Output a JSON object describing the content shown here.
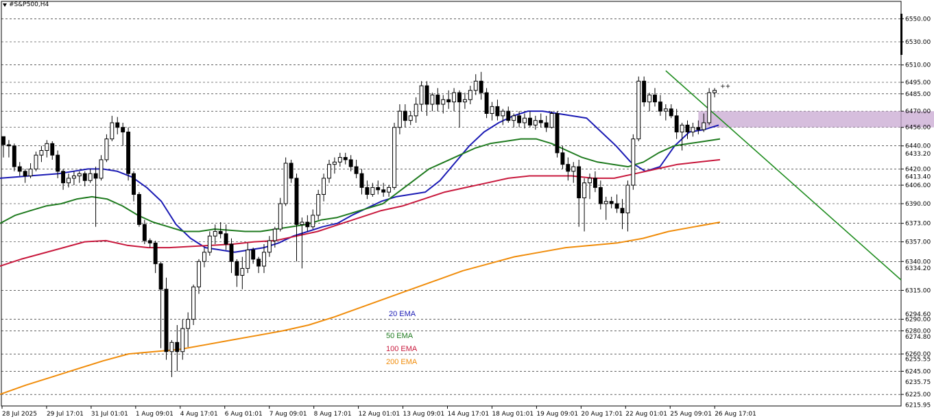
{
  "symbol_label": "#S&P500,H4",
  "colors": {
    "ema20": "#1a1ab4",
    "ema50": "#1e7a1e",
    "ema100": "#c8183c",
    "ema200": "#f08c0a",
    "trendline": "#1e8c1e",
    "zone": "#c8a8d2",
    "grid": "#000000"
  },
  "chart_data": {
    "type": "candlestick",
    "title": "#S&P500,H4",
    "ylim": [
      6215,
      6565
    ],
    "grid": true,
    "y_levels": [
      {
        "label": "6550.00",
        "value": 6550.0
      },
      {
        "label": "6530.00",
        "value": 6530.0
      },
      {
        "label": "6510.00",
        "value": 6510.0
      },
      {
        "label": "6495.00",
        "value": 6495.0
      },
      {
        "label": "6485.00",
        "value": 6485.0
      },
      {
        "label": "6470.00",
        "value": 6470.0
      },
      {
        "label": "6456.00",
        "value": 6456.0
      },
      {
        "label": "6440.00",
        "value": 6440.0
      },
      {
        "label": "6420.00",
        "value": 6420.0
      },
      {
        "label": "6406.00",
        "value": 6406.0
      },
      {
        "label": "6390.00",
        "value": 6390.0
      },
      {
        "label": "6373.00",
        "value": 6373.0
      },
      {
        "label": "6357.00",
        "value": 6357.0
      },
      {
        "label": "6340.00",
        "value": 6340.0
      },
      {
        "label": "6315.00",
        "value": 6315.0
      },
      {
        "label": "6290.00",
        "value": 6290.0
      },
      {
        "label": "6280.00",
        "value": 6280.0
      },
      {
        "label": "6260.00",
        "value": 6260.0
      },
      {
        "label": "6245.00",
        "value": 6245.0
      },
      {
        "label": "6225.00",
        "value": 6225.0
      }
    ],
    "y_minor_labels": [
      "6433.20",
      "6413.40",
      "6334.20",
      "6294.60",
      "6274.80",
      "6255.55",
      "6235.75",
      "6215.95"
    ],
    "x_ticks": [
      {
        "label": "28 Jul 2025",
        "x": 0
      },
      {
        "label": "29 Jul 17:01",
        "x": 11
      },
      {
        "label": "31 Jul 01:01",
        "x": 22
      },
      {
        "label": "1 Aug 09:01",
        "x": 33
      },
      {
        "label": "4 Aug 17:01",
        "x": 44
      },
      {
        "label": "6 Aug 01:01",
        "x": 55
      },
      {
        "label": "7 Aug 09:01",
        "x": 66
      },
      {
        "label": "8 Aug 17:01",
        "x": 77
      },
      {
        "label": "12 Aug 01:01",
        "x": 88
      },
      {
        "label": "13 Aug 09:01",
        "x": 99
      },
      {
        "label": "14 Aug 17:01",
        "x": 110
      },
      {
        "label": "18 Aug 01:01",
        "x": 121
      },
      {
        "label": "19 Aug 09:01",
        "x": 132
      },
      {
        "label": "20 Aug 17:01",
        "x": 143
      },
      {
        "label": "22 Aug 01:01",
        "x": 154
      },
      {
        "label": "25 Aug 09:01",
        "x": 165
      },
      {
        "label": "26 Aug 17:01",
        "x": 176
      }
    ],
    "candles": [
      [
        6448,
        6448,
        6430,
        6441
      ],
      [
        6441,
        6445,
        6430,
        6440
      ],
      [
        6440,
        6442,
        6418,
        6422
      ],
      [
        6422,
        6426,
        6414,
        6418
      ],
      [
        6418,
        6420,
        6408,
        6414
      ],
      [
        6414,
        6425,
        6412,
        6420
      ],
      [
        6420,
        6435,
        6418,
        6432
      ],
      [
        6432,
        6440,
        6426,
        6436
      ],
      [
        6436,
        6445,
        6430,
        6442
      ],
      [
        6442,
        6444,
        6428,
        6432
      ],
      [
        6432,
        6436,
        6412,
        6418
      ],
      [
        6418,
        6420,
        6402,
        6408
      ],
      [
        6408,
        6416,
        6404,
        6412
      ],
      [
        6412,
        6418,
        6406,
        6414
      ],
      [
        6414,
        6418,
        6408,
        6416
      ],
      [
        6416,
        6418,
        6405,
        6410
      ],
      [
        6410,
        6420,
        6408,
        6416
      ],
      [
        6416,
        6422,
        6370,
        6412
      ],
      [
        6412,
        6432,
        6410,
        6428
      ],
      [
        6428,
        6450,
        6426,
        6446
      ],
      [
        6446,
        6466,
        6444,
        6460
      ],
      [
        6460,
        6465,
        6450,
        6456
      ],
      [
        6456,
        6460,
        6440,
        6452
      ],
      [
        6452,
        6456,
        6410,
        6416
      ],
      [
        6416,
        6418,
        6392,
        6398
      ],
      [
        6398,
        6400,
        6370,
        6372
      ],
      [
        6372,
        6376,
        6355,
        6358
      ],
      [
        6358,
        6360,
        6352,
        6356
      ],
      [
        6356,
        6358,
        6330,
        6338
      ],
      [
        6338,
        6340,
        6265,
        6316
      ],
      [
        6316,
        6326,
        6255,
        6262
      ],
      [
        6262,
        6272,
        6240,
        6270
      ],
      [
        6270,
        6285,
        6245,
        6262
      ],
      [
        6262,
        6290,
        6255,
        6282
      ],
      [
        6282,
        6296,
        6266,
        6290
      ],
      [
        6290,
        6320,
        6285,
        6318
      ],
      [
        6318,
        6342,
        6312,
        6340
      ],
      [
        6340,
        6352,
        6335,
        6348
      ],
      [
        6348,
        6366,
        6345,
        6362
      ],
      [
        6362,
        6372,
        6355,
        6366
      ],
      [
        6366,
        6374,
        6360,
        6364
      ],
      [
        6364,
        6372,
        6350,
        6355
      ],
      [
        6355,
        6360,
        6330,
        6340
      ],
      [
        6340,
        6342,
        6318,
        6328
      ],
      [
        6328,
        6344,
        6316,
        6334
      ],
      [
        6334,
        6356,
        6330,
        6350
      ],
      [
        6350,
        6352,
        6338,
        6342
      ],
      [
        6342,
        6344,
        6330,
        6336
      ],
      [
        6336,
        6355,
        6330,
        6348
      ],
      [
        6348,
        6362,
        6344,
        6358
      ],
      [
        6358,
        6370,
        6352,
        6368
      ],
      [
        6368,
        6395,
        6366,
        6390
      ],
      [
        6390,
        6430,
        6388,
        6425
      ],
      [
        6425,
        6428,
        6408,
        6412
      ],
      [
        6412,
        6416,
        6340,
        6372
      ],
      [
        6372,
        6378,
        6334,
        6374
      ],
      [
        6374,
        6380,
        6366,
        6370
      ],
      [
        6370,
        6385,
        6368,
        6380
      ],
      [
        6380,
        6402,
        6376,
        6398
      ],
      [
        6398,
        6416,
        6392,
        6412
      ],
      [
        6412,
        6428,
        6408,
        6424
      ],
      [
        6424,
        6430,
        6416,
        6426
      ],
      [
        6426,
        6434,
        6422,
        6430
      ],
      [
        6430,
        6434,
        6424,
        6428
      ],
      [
        6428,
        6432,
        6418,
        6422
      ],
      [
        6422,
        6428,
        6412,
        6416
      ],
      [
        6416,
        6420,
        6398,
        6404
      ],
      [
        6404,
        6410,
        6394,
        6398
      ],
      [
        6398,
        6408,
        6396,
        6404
      ],
      [
        6404,
        6410,
        6398,
        6402
      ],
      [
        6402,
        6408,
        6396,
        6400
      ],
      [
        6400,
        6406,
        6396,
        6404
      ],
      [
        6404,
        6460,
        6402,
        6456
      ],
      [
        6456,
        6476,
        6450,
        6470
      ],
      [
        6470,
        6476,
        6456,
        6462
      ],
      [
        6462,
        6470,
        6458,
        6466
      ],
      [
        6466,
        6482,
        6460,
        6476
      ],
      [
        6476,
        6496,
        6470,
        6492
      ],
      [
        6492,
        6496,
        6466,
        6476
      ],
      [
        6476,
        6486,
        6470,
        6484
      ],
      [
        6484,
        6490,
        6470,
        6476
      ],
      [
        6476,
        6484,
        6468,
        6480
      ],
      [
        6480,
        6488,
        6472,
        6478
      ],
      [
        6478,
        6490,
        6470,
        6486
      ],
      [
        6486,
        6488,
        6456,
        6478
      ],
      [
        6478,
        6486,
        6472,
        6480
      ],
      [
        6480,
        6492,
        6476,
        6488
      ],
      [
        6488,
        6502,
        6484,
        6496
      ],
      [
        6496,
        6504,
        6480,
        6486
      ],
      [
        6486,
        6490,
        6464,
        6468
      ],
      [
        6468,
        6478,
        6462,
        6474
      ],
      [
        6474,
        6480,
        6462,
        6466
      ],
      [
        6466,
        6472,
        6458,
        6470
      ],
      [
        6470,
        6474,
        6460,
        6462
      ],
      [
        6462,
        6468,
        6456,
        6466
      ],
      [
        6466,
        6470,
        6456,
        6460
      ],
      [
        6460,
        6468,
        6455,
        6464
      ],
      [
        6464,
        6470,
        6456,
        6458
      ],
      [
        6458,
        6466,
        6454,
        6462
      ],
      [
        6462,
        6468,
        6456,
        6460
      ],
      [
        6460,
        6466,
        6452,
        6456
      ],
      [
        6456,
        6470,
        6455,
        6468
      ],
      [
        6468,
        6470,
        6430,
        6434
      ],
      [
        6434,
        6440,
        6420,
        6424
      ],
      [
        6424,
        6430,
        6410,
        6418
      ],
      [
        6418,
        6426,
        6408,
        6422
      ],
      [
        6422,
        6428,
        6370,
        6395
      ],
      [
        6395,
        6412,
        6366,
        6408
      ],
      [
        6408,
        6416,
        6394,
        6412
      ],
      [
        6412,
        6418,
        6400,
        6404
      ],
      [
        6404,
        6410,
        6385,
        6390
      ],
      [
        6390,
        6396,
        6376,
        6392
      ],
      [
        6392,
        6396,
        6386,
        6390
      ],
      [
        6390,
        6398,
        6382,
        6386
      ],
      [
        6386,
        6394,
        6368,
        6382
      ],
      [
        6382,
        6410,
        6366,
        6406
      ],
      [
        6406,
        6450,
        6402,
        6446
      ],
      [
        6446,
        6500,
        6444,
        6496
      ],
      [
        6496,
        6500,
        6474,
        6478
      ],
      [
        6478,
        6486,
        6470,
        6484
      ],
      [
        6484,
        6490,
        6474,
        6478
      ],
      [
        6478,
        6484,
        6466,
        6470
      ],
      [
        6470,
        6476,
        6462,
        6472
      ],
      [
        6472,
        6476,
        6464,
        6466
      ],
      [
        6466,
        6472,
        6446,
        6452
      ],
      [
        6452,
        6460,
        6436,
        6458
      ],
      [
        6458,
        6462,
        6446,
        6452
      ],
      [
        6452,
        6460,
        6448,
        6456
      ],
      [
        6456,
        6462,
        6450,
        6454
      ],
      [
        6454,
        6468,
        6452,
        6460
      ],
      [
        6460,
        6490,
        6458,
        6486
      ],
      [
        6486,
        6490,
        6482,
        6488
      ]
    ],
    "series": [
      {
        "name": "20 EMA",
        "values": [
          6412,
          6413,
          6414,
          6415,
          6416,
          6418,
          6420,
          6420,
          6418,
          6413,
          6404,
          6392,
          6372,
          6360,
          6352,
          6350,
          6348,
          6350,
          6352,
          6356,
          6362,
          6366,
          6370,
          6373,
          6380,
          6386,
          6392,
          6396,
          6398,
          6400,
          6410,
          6425,
          6440,
          6452,
          6460,
          6466,
          6470,
          6470,
          6468,
          6466,
          6464,
          6452,
          6440,
          6426,
          6418,
          6422,
          6440,
          6452,
          6454,
          6458
        ]
      },
      {
        "name": "50 EMA",
        "values": [
          6373,
          6380,
          6384,
          6388,
          6390,
          6394,
          6396,
          6394,
          6388,
          6380,
          6374,
          6370,
          6366,
          6366,
          6368,
          6367,
          6366,
          6366,
          6368,
          6370,
          6372,
          6376,
          6378,
          6382,
          6386,
          6390,
          6400,
          6410,
          6420,
          6426,
          6432,
          6438,
          6442,
          6444,
          6446,
          6446,
          6442,
          6436,
          6430,
          6426,
          6424,
          6422,
          6426,
          6434,
          6440,
          6442,
          6444,
          6446
        ]
      },
      {
        "name": "100 EMA",
        "values": [
          6336,
          6342,
          6347,
          6352,
          6357,
          6358,
          6354,
          6352,
          6352,
          6353,
          6354,
          6355,
          6357,
          6358,
          6362,
          6366,
          6372,
          6378,
          6384,
          6388,
          6394,
          6400,
          6404,
          6408,
          6412,
          6414,
          6414,
          6414,
          6412,
          6412,
          6416,
          6420,
          6424,
          6426,
          6428
        ]
      },
      {
        "name": "200 EMA",
        "values": [
          6225,
          6233,
          6240,
          6247,
          6254,
          6260,
          6262,
          6264,
          6268,
          6272,
          6276,
          6280,
          6285,
          6292,
          6300,
          6308,
          6316,
          6324,
          6332,
          6338,
          6344,
          6348,
          6352,
          6354,
          6356,
          6360,
          6366,
          6370,
          6374
        ]
      }
    ],
    "series_x_start": [
      0,
      0,
      0,
      0
    ],
    "trendline": {
      "from": [
        122,
        6505
      ],
      "to": [
        null,
        6324
      ]
    },
    "zone": {
      "from": 128,
      "to": 190,
      "low": 6456,
      "high": 6470
    },
    "legend": [
      {
        "label": "20 EMA",
        "color": "#1a1ab4"
      },
      {
        "label": "50 EMA",
        "color": "#1e7a1e"
      },
      {
        "label": "100 EMA",
        "color": "#c8183c"
      },
      {
        "label": "200 EMA",
        "color": "#f08c0a"
      }
    ]
  }
}
